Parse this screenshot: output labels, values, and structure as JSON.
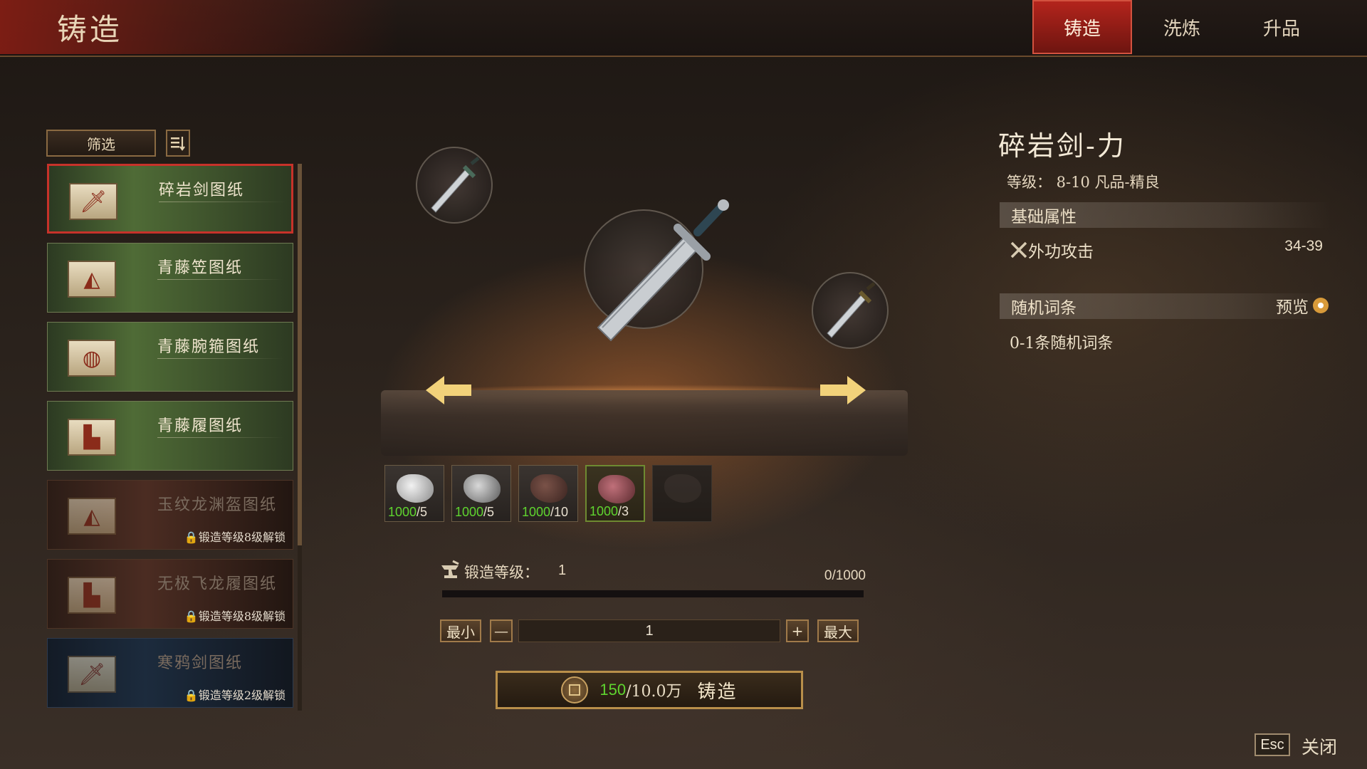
{
  "header": {
    "title": "铸造",
    "tabs": [
      {
        "label": "铸造",
        "active": true
      },
      {
        "label": "洗炼",
        "active": false
      },
      {
        "label": "升品",
        "active": false
      }
    ]
  },
  "sidebar": {
    "filter_label": "筛选",
    "sort_icon": "sort-list-icon",
    "items": [
      {
        "name": "碎岩剑图纸",
        "icon": "sword-icon",
        "lock": "",
        "state": "green",
        "selected": true
      },
      {
        "name": "青藤笠图纸",
        "icon": "hat-icon",
        "lock": "",
        "state": "green",
        "selected": false
      },
      {
        "name": "青藤腕箍图纸",
        "icon": "bracer-icon",
        "lock": "",
        "state": "green",
        "selected": false
      },
      {
        "name": "青藤履图纸",
        "icon": "boots-icon",
        "lock": "",
        "state": "green",
        "selected": false
      },
      {
        "name": "玉纹龙渊盔图纸",
        "icon": "hat-icon",
        "lock": "锻造等级8级解锁",
        "state": "red",
        "selected": false
      },
      {
        "name": "无极飞龙履图纸",
        "icon": "boots-icon",
        "lock": "锻造等级8级解锁",
        "state": "red",
        "selected": false
      },
      {
        "name": "寒鸦剑图纸",
        "icon": "sword-icon",
        "lock": "锻造等级2级解锁",
        "state": "blue",
        "selected": false
      }
    ]
  },
  "center": {
    "materials": [
      {
        "have": "1000",
        "need": "/5",
        "icon": "silver-ore-icon"
      },
      {
        "have": "1000",
        "need": "/5",
        "icon": "gray-ore-icon"
      },
      {
        "have": "1000",
        "need": "/10",
        "icon": "dark-ore-icon"
      },
      {
        "have": "1000",
        "need": "/3",
        "icon": "red-ore-icon"
      },
      {
        "have": "",
        "need": "",
        "icon": "empty-slot-icon"
      }
    ],
    "forge_level_label": "锻造等级：",
    "forge_level_value": "1",
    "forge_progress_text": "0/1000",
    "forge_progress_fraction": 0.0,
    "qty": {
      "min_label": "最小",
      "minus_label": "—",
      "value": "1",
      "plus_label": "+",
      "max_label": "最大"
    },
    "forge_button": {
      "cost_have": "150",
      "cost_need": "/10.0万",
      "label": "铸造"
    }
  },
  "detail": {
    "name": "碎岩剑-力",
    "level_line": "等级：  8-10   凡品-精良",
    "base_section": "基础属性",
    "stat_name": "外功攻击",
    "stat_value": "34-39",
    "random_section": "随机词条",
    "preview_label": "预览",
    "random_desc": "0-1条随机词条"
  },
  "footer": {
    "esc_label": "Esc",
    "close_label": "关闭"
  },
  "colors": {
    "accent_red": "#b3241c",
    "have_green": "#5fd42f",
    "gold_border": "#b98f4a"
  }
}
